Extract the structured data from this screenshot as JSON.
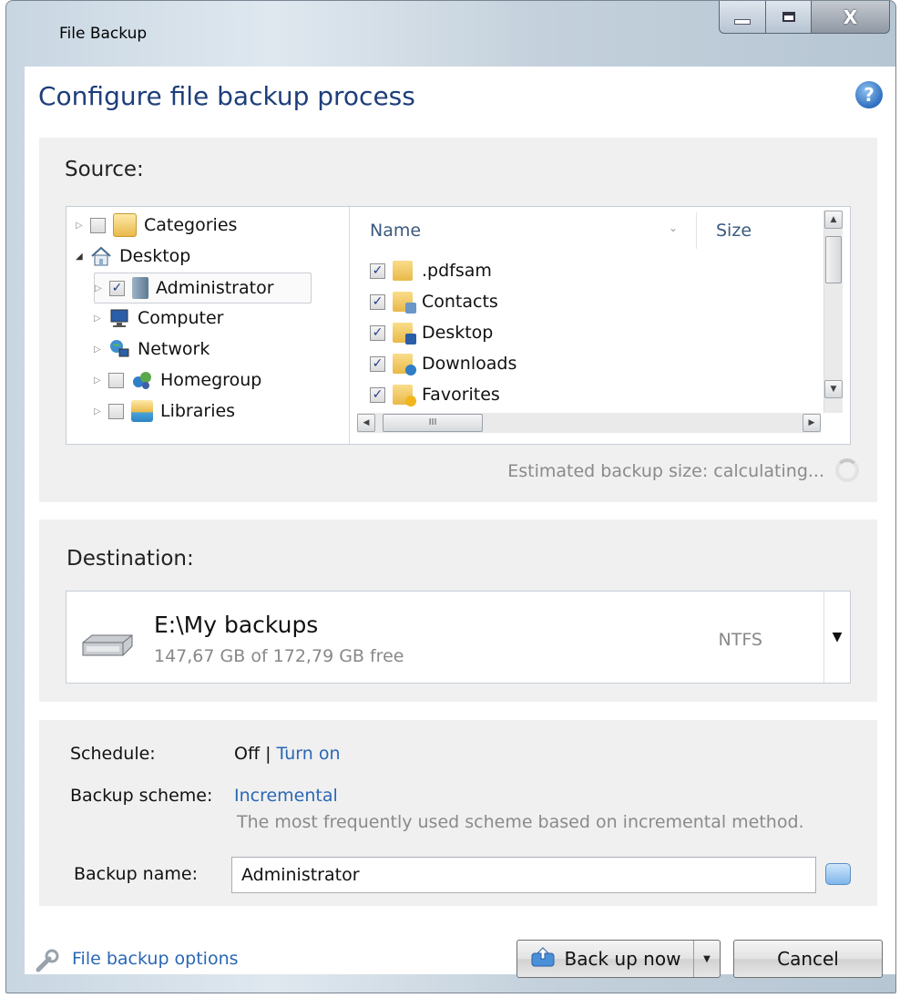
{
  "window": {
    "title": "File Backup"
  },
  "header": {
    "title": "Configure file backup process"
  },
  "source": {
    "label": "Source:",
    "tree": [
      {
        "label": "Categories",
        "checked": false
      },
      {
        "label": "Desktop"
      },
      {
        "label": "Administrator",
        "checked": true
      },
      {
        "label": "Computer"
      },
      {
        "label": "Network"
      },
      {
        "label": "Homegroup",
        "checked": false
      },
      {
        "label": "Libraries",
        "checked": false
      }
    ],
    "columns": {
      "name": "Name",
      "size": "Size"
    },
    "files": [
      {
        "name": ".pdfsam",
        "checked": true
      },
      {
        "name": "Contacts",
        "checked": true
      },
      {
        "name": "Desktop",
        "checked": true
      },
      {
        "name": "Downloads",
        "checked": true
      },
      {
        "name": "Favorites",
        "checked": true
      }
    ],
    "hscroll_grip": "III",
    "estimated": "Estimated backup size: calculating..."
  },
  "destination": {
    "label": "Destination:",
    "path": "E:\\My backups",
    "free": "147,67 GB of 172,79 GB free",
    "filesystem": "NTFS"
  },
  "settings": {
    "schedule_label": "Schedule:",
    "schedule_state": "Off |",
    "schedule_link": "Turn on",
    "scheme_label": "Backup scheme:",
    "scheme_value": "Incremental",
    "scheme_desc": "The most frequently used scheme based on incremental method.",
    "name_label": "Backup name:",
    "name_value": "Administrator"
  },
  "footer": {
    "options_link": "File backup options",
    "backup_button": "Back up now",
    "cancel_button": "Cancel"
  },
  "colors": {
    "link": "#2a67b5",
    "title": "#1e3e7a"
  }
}
